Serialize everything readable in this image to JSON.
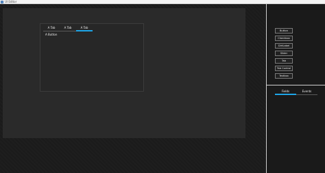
{
  "window": {
    "title": "UI Editor"
  },
  "tab_control": {
    "tabs": [
      {
        "label": "A Tab",
        "active": false
      },
      {
        "label": "A Tab",
        "active": false
      },
      {
        "label": "A Tab",
        "active": true
      }
    ],
    "content_label": "A Button"
  },
  "toolbox": {
    "items": [
      "Button",
      "Checkbox",
      "DirtLabel",
      "Slider",
      "Tab",
      "Tab Control",
      "Textbox"
    ]
  },
  "properties": {
    "tabs": [
      {
        "label": "Fields",
        "active": true
      },
      {
        "label": "Events",
        "active": false
      }
    ]
  },
  "colors": {
    "accent": "#1ea6e8",
    "background": "#1c1c1c",
    "canvas": "#2a2a2a"
  }
}
